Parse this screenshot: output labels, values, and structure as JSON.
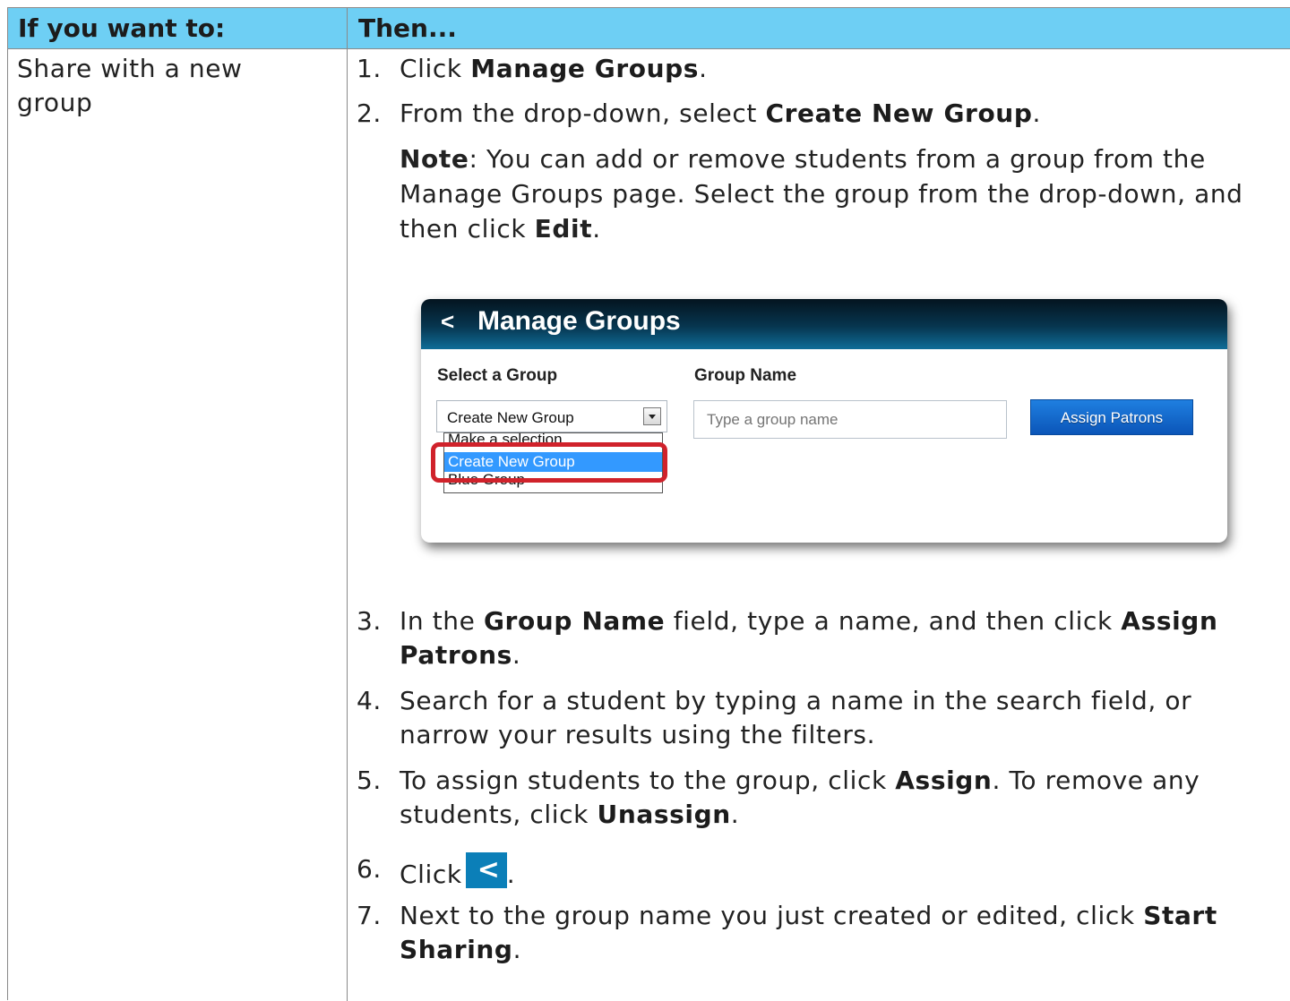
{
  "table": {
    "header": {
      "col1": "If you want to:",
      "col2": "Then..."
    },
    "row": {
      "task": "Share with a new group"
    }
  },
  "steps": {
    "s1": {
      "num": "1.",
      "pre": "Click ",
      "bold": "Manage Groups",
      "post": "."
    },
    "s2": {
      "num": "2.",
      "pre": "From the drop-down, select ",
      "bold": "Create New Group",
      "post": "."
    },
    "note": {
      "bold1": "Note",
      "text1": ": You can add or remove students from a group from the Manage Groups page. Select the group from the drop-down, and then click ",
      "bold2": "Edit",
      "post": "."
    },
    "s3": {
      "num": "3.",
      "pre": "In the ",
      "bold1": "Group Name",
      "mid": " field, type a name, and then click ",
      "bold2": "Assign Patrons",
      "post": "."
    },
    "s4": {
      "num": "4.",
      "text": "Search for a student by typing a name in the search field, or narrow your results using the filters."
    },
    "s5": {
      "num": "5.",
      "pre": "To assign students to the group, click ",
      "bold1": "Assign",
      "mid": ". To remove any students, click ",
      "bold2": "Unassign",
      "post": "."
    },
    "s6": {
      "num": "6.",
      "pre": "Click",
      "icon_glyph": "<",
      "post": "."
    },
    "s7": {
      "num": "7.",
      "pre": "Next to the group name you just created or edited, click ",
      "bold": "Start Sharing",
      "post": "."
    }
  },
  "screenshot": {
    "back_glyph": "<",
    "title": "Manage Groups",
    "select_label": "Select a Group",
    "group_name_label": "Group Name",
    "select_value": "Create New Group",
    "options": [
      "Make a selection",
      "Create New Group",
      "Blue Group"
    ],
    "group_name_placeholder": "Type a group name",
    "assign_button": "Assign Patrons"
  },
  "colors": {
    "header_bg": "#6ecff4",
    "highlight": "#d0222b",
    "assign_button": "#1565c8",
    "back_icon_bg": "#0b7fb8"
  }
}
